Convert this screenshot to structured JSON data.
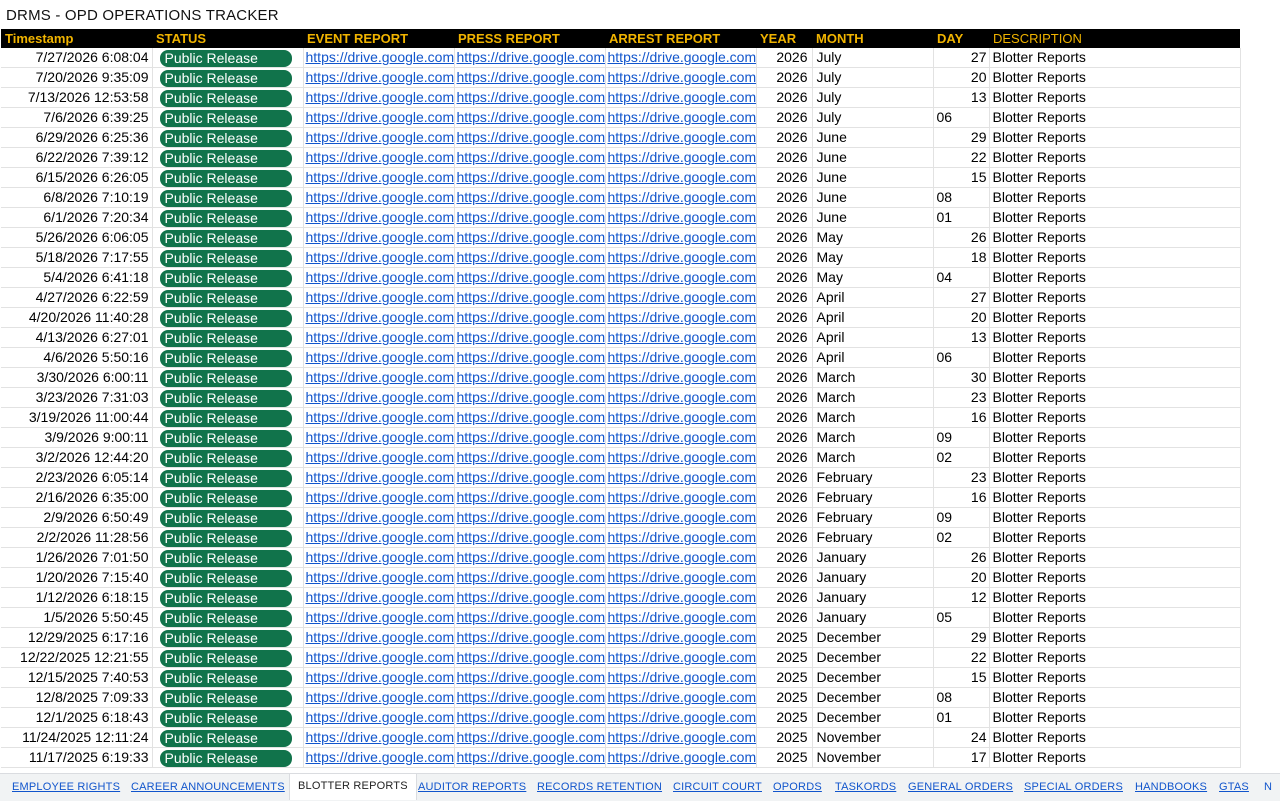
{
  "title": "DRMS - OPD OPERATIONS TRACKER",
  "columns": [
    "Timestamp",
    "STATUS",
    "EVENT REPORT",
    "PRESS REPORT",
    "ARREST REPORT",
    "YEAR",
    "MONTH",
    "DAY",
    "DESCRIPTION"
  ],
  "link_text": "https://drive.google.com",
  "rows": [
    {
      "ts": "7/27/2026 6:08:04",
      "status": "Public Release",
      "year": "2026",
      "month": "July",
      "day": "27",
      "desc": "Blotter Reports"
    },
    {
      "ts": "7/20/2026 9:35:09",
      "status": "Public Release",
      "year": "2026",
      "month": "July",
      "day": "20",
      "desc": "Blotter Reports"
    },
    {
      "ts": "7/13/2026 12:53:58",
      "status": "Public Release",
      "year": "2026",
      "month": "July",
      "day": "13",
      "desc": "Blotter Reports"
    },
    {
      "ts": "7/6/2026 6:39:25",
      "status": "Public Release",
      "year": "2026",
      "month": "July",
      "day": "06",
      "desc": "Blotter Reports"
    },
    {
      "ts": "6/29/2026 6:25:36",
      "status": "Public Release",
      "year": "2026",
      "month": "June",
      "day": "29",
      "desc": "Blotter Reports"
    },
    {
      "ts": "6/22/2026 7:39:12",
      "status": "Public Release",
      "year": "2026",
      "month": "June",
      "day": "22",
      "desc": "Blotter Reports"
    },
    {
      "ts": "6/15/2026 6:26:05",
      "status": "Public Release",
      "year": "2026",
      "month": "June",
      "day": "15",
      "desc": "Blotter Reports"
    },
    {
      "ts": "6/8/2026 7:10:19",
      "status": "Public Release",
      "year": "2026",
      "month": "June",
      "day": "08",
      "desc": "Blotter Reports"
    },
    {
      "ts": "6/1/2026 7:20:34",
      "status": "Public Release",
      "year": "2026",
      "month": "June",
      "day": "01",
      "desc": "Blotter Reports"
    },
    {
      "ts": "5/26/2026 6:06:05",
      "status": "Public Release",
      "year": "2026",
      "month": "May",
      "day": "26",
      "desc": "Blotter Reports"
    },
    {
      "ts": "5/18/2026 7:17:55",
      "status": "Public Release",
      "year": "2026",
      "month": "May",
      "day": "18",
      "desc": "Blotter Reports"
    },
    {
      "ts": "5/4/2026 6:41:18",
      "status": "Public Release",
      "year": "2026",
      "month": "May",
      "day": "04",
      "desc": "Blotter Reports"
    },
    {
      "ts": "4/27/2026 6:22:59",
      "status": "Public Release",
      "year": "2026",
      "month": "April",
      "day": "27",
      "desc": "Blotter Reports"
    },
    {
      "ts": "4/20/2026 11:40:28",
      "status": "Public Release",
      "year": "2026",
      "month": "April",
      "day": "20",
      "desc": "Blotter Reports"
    },
    {
      "ts": "4/13/2026 6:27:01",
      "status": "Public Release",
      "year": "2026",
      "month": "April",
      "day": "13",
      "desc": "Blotter Reports"
    },
    {
      "ts": "4/6/2026 5:50:16",
      "status": "Public Release",
      "year": "2026",
      "month": "April",
      "day": "06",
      "desc": "Blotter Reports"
    },
    {
      "ts": "3/30/2026 6:00:11",
      "status": "Public Release",
      "year": "2026",
      "month": "March",
      "day": "30",
      "desc": "Blotter Reports"
    },
    {
      "ts": "3/23/2026 7:31:03",
      "status": "Public Release",
      "year": "2026",
      "month": "March",
      "day": "23",
      "desc": "Blotter Reports"
    },
    {
      "ts": "3/19/2026 11:00:44",
      "status": "Public Release",
      "year": "2026",
      "month": "March",
      "day": "16",
      "desc": "Blotter Reports"
    },
    {
      "ts": "3/9/2026 9:00:11",
      "status": "Public Release",
      "year": "2026",
      "month": "March",
      "day": "09",
      "desc": "Blotter Reports"
    },
    {
      "ts": "3/2/2026 12:44:20",
      "status": "Public Release",
      "year": "2026",
      "month": "March",
      "day": "02",
      "desc": "Blotter Reports"
    },
    {
      "ts": "2/23/2026 6:05:14",
      "status": "Public Release",
      "year": "2026",
      "month": "February",
      "day": "23",
      "desc": "Blotter Reports"
    },
    {
      "ts": "2/16/2026 6:35:00",
      "status": "Public Release",
      "year": "2026",
      "month": "February",
      "day": "16",
      "desc": "Blotter Reports"
    },
    {
      "ts": "2/9/2026 6:50:49",
      "status": "Public Release",
      "year": "2026",
      "month": "February",
      "day": "09",
      "desc": "Blotter Reports"
    },
    {
      "ts": "2/2/2026 11:28:56",
      "status": "Public Release",
      "year": "2026",
      "month": "February",
      "day": "02",
      "desc": "Blotter Reports"
    },
    {
      "ts": "1/26/2026 7:01:50",
      "status": "Public Release",
      "year": "2026",
      "month": "January",
      "day": "26",
      "desc": "Blotter Reports"
    },
    {
      "ts": "1/20/2026 7:15:40",
      "status": "Public Release",
      "year": "2026",
      "month": "January",
      "day": "20",
      "desc": "Blotter Reports"
    },
    {
      "ts": "1/12/2026 6:18:15",
      "status": "Public Release",
      "year": "2026",
      "month": "January",
      "day": "12",
      "desc": "Blotter Reports"
    },
    {
      "ts": "1/5/2026 5:50:45",
      "status": "Public Release",
      "year": "2026",
      "month": "January",
      "day": "05",
      "desc": "Blotter Reports"
    },
    {
      "ts": "12/29/2025 6:17:16",
      "status": "Public Release",
      "year": "2025",
      "month": "December",
      "day": "29",
      "desc": "Blotter Reports"
    },
    {
      "ts": "12/22/2025 12:21:55",
      "status": "Public Release",
      "year": "2025",
      "month": "December",
      "day": "22",
      "desc": "Blotter Reports"
    },
    {
      "ts": "12/15/2025 7:40:53",
      "status": "Public Release",
      "year": "2025",
      "month": "December",
      "day": "15",
      "desc": "Blotter Reports"
    },
    {
      "ts": "12/8/2025 7:09:33",
      "status": "Public Release",
      "year": "2025",
      "month": "December",
      "day": "08",
      "desc": "Blotter Reports"
    },
    {
      "ts": "12/1/2025 6:18:43",
      "status": "Public Release",
      "year": "2025",
      "month": "December",
      "day": "01",
      "desc": "Blotter Reports"
    },
    {
      "ts": "11/24/2025 12:11:24",
      "status": "Public Release",
      "year": "2025",
      "month": "November",
      "day": "24",
      "desc": "Blotter Reports"
    },
    {
      "ts": "11/17/2025 6:19:33",
      "status": "Public Release",
      "year": "2025",
      "month": "November",
      "day": "17",
      "desc": "Blotter Reports"
    }
  ],
  "tabs": [
    {
      "label": "EMPLOYEE RIGHTS",
      "active": false
    },
    {
      "label": "CAREER ANNOUNCEMENTS",
      "active": false
    },
    {
      "label": "BLOTTER REPORTS",
      "active": true
    },
    {
      "label": "AUDITOR REPORTS",
      "active": false
    },
    {
      "label": "RECORDS RETENTION",
      "active": false
    },
    {
      "label": "CIRCUIT COURT",
      "active": false
    },
    {
      "label": "OPORDS",
      "active": false
    },
    {
      "label": "TASKORDS",
      "active": false
    },
    {
      "label": "GENERAL ORDERS",
      "active": false
    },
    {
      "label": "SPECIAL ORDERS",
      "active": false
    },
    {
      "label": "HANDBOOKS",
      "active": false
    },
    {
      "label": "GTAS",
      "active": false
    }
  ],
  "tabs_overflow": "N",
  "colors": {
    "header_bg": "#000000",
    "header_text": "#f1b400",
    "status_pill": "#11734b",
    "link": "#1155cc"
  }
}
